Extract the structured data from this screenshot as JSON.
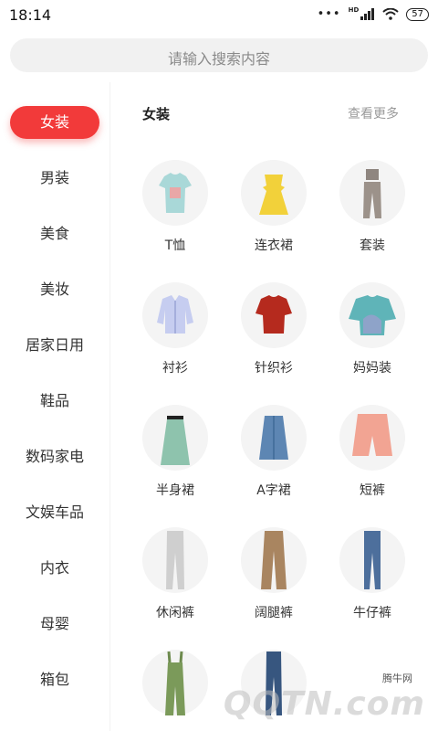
{
  "status": {
    "time": "18:14",
    "network": "HD",
    "battery": "57"
  },
  "search": {
    "placeholder": "请输入搜索内容"
  },
  "sidebar": {
    "items": [
      {
        "label": "女装",
        "active": true
      },
      {
        "label": "男装"
      },
      {
        "label": "美食"
      },
      {
        "label": "美妆"
      },
      {
        "label": "居家日用"
      },
      {
        "label": "鞋品"
      },
      {
        "label": "数码家电"
      },
      {
        "label": "文娱车品"
      },
      {
        "label": "内衣"
      },
      {
        "label": "母婴"
      },
      {
        "label": "箱包"
      }
    ]
  },
  "content": {
    "title": "女装",
    "more": "查看更多",
    "items": [
      {
        "label": "T恤",
        "icon": "tshirt-icon"
      },
      {
        "label": "连衣裙",
        "icon": "dress-icon"
      },
      {
        "label": "套装",
        "icon": "suit-set-icon"
      },
      {
        "label": "衬衫",
        "icon": "shirt-icon"
      },
      {
        "label": "针织衫",
        "icon": "knit-sweater-icon"
      },
      {
        "label": "妈妈装",
        "icon": "mom-top-icon"
      },
      {
        "label": "半身裙",
        "icon": "skirt-icon"
      },
      {
        "label": "A字裙",
        "icon": "a-line-skirt-icon"
      },
      {
        "label": "短裤",
        "icon": "shorts-icon"
      },
      {
        "label": "休闲裤",
        "icon": "casual-pants-icon"
      },
      {
        "label": "阔腿裤",
        "icon": "wide-leg-pants-icon"
      },
      {
        "label": "牛仔裤",
        "icon": "jeans-icon"
      },
      {
        "label": "",
        "icon": "overalls-icon"
      },
      {
        "label": "",
        "icon": "jeans-2-icon"
      }
    ]
  },
  "watermark": {
    "small": "腾牛网",
    "big": "QQTN.com"
  },
  "colors": {
    "accent": "#f23a3a",
    "search_bg": "#f1f1f1",
    "muted_text": "#9a9a9a"
  }
}
